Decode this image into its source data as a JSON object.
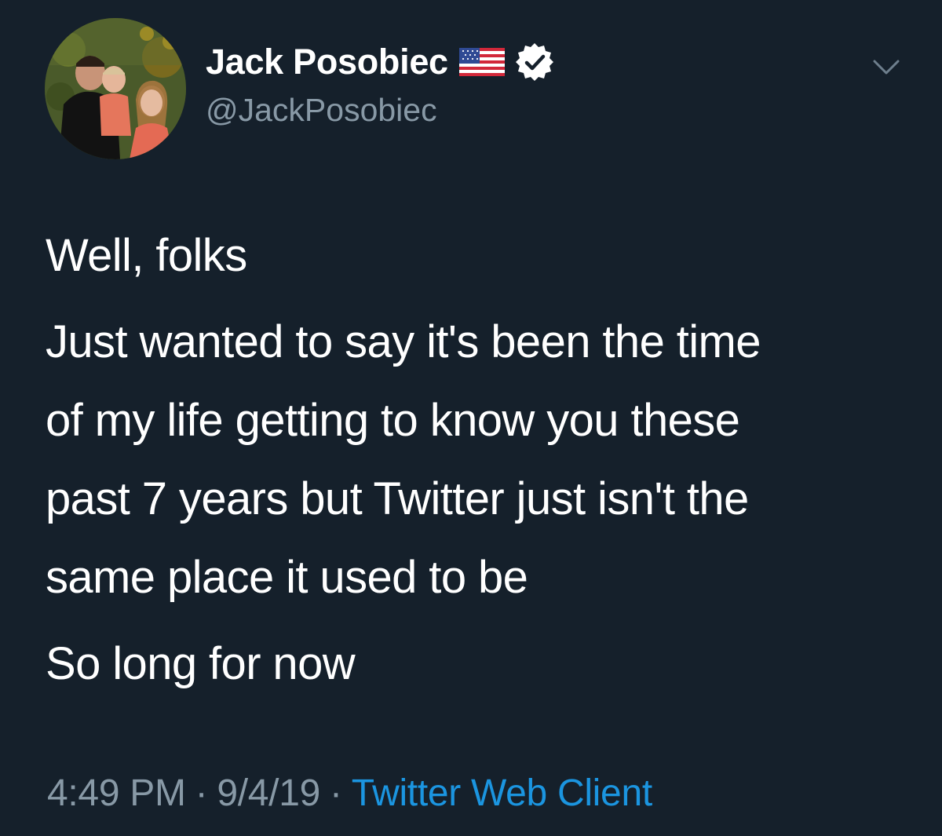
{
  "colors": {
    "background": "#15202b",
    "text_primary": "#ffffff",
    "text_secondary": "#8899a6",
    "link": "#1b95e0"
  },
  "author": {
    "display_name": "Jack Posobiec",
    "handle": "@JackPosobiec",
    "flag_icon": "us-flag-icon",
    "verified_icon": "verified-badge-icon",
    "avatar_icon": "avatar-photo"
  },
  "menu": {
    "icon": "chevron-down-icon"
  },
  "tweet": {
    "lines": {
      "p1": "Well, folks",
      "p2_l1": "Just wanted to say it's been the time",
      "p2_l2": "of my life getting to know you these",
      "p2_l3": "past 7 years but Twitter just isn't the",
      "p2_l4": "same place it used to be",
      "p3": "So long for now"
    }
  },
  "meta": {
    "time": "4:49 PM",
    "separator": "·",
    "date": "9/4/19",
    "source": "Twitter Web Client"
  }
}
